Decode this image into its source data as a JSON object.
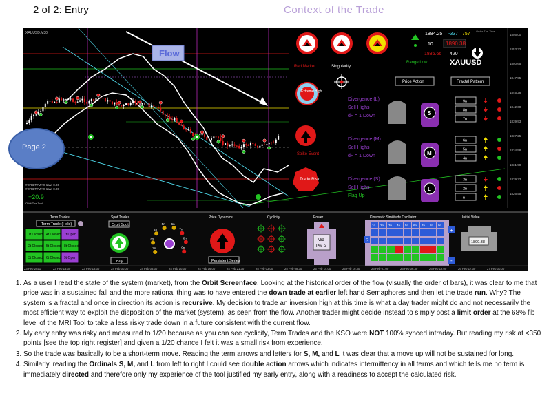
{
  "header": {
    "title": "2 of 2: Entry",
    "context": "Context of the Trade"
  },
  "chart": {
    "flow_label": "Flow",
    "symbol_info": "XAUUSD,M30",
    "prices": [
      "1856.00",
      "1853.33",
      "1850.65",
      "1847.95",
      "1845.28",
      "1842.60",
      "1839.93",
      "1837.25",
      "1834.58",
      "1831.90",
      "1829.23",
      "1826.55"
    ],
    "dates": [
      "23 Feb 2021",
      "23 Feb 13:30",
      "23 Feb 18:30",
      "24 Feb 00:00",
      "24 Feb 05:30",
      "24 Feb 10:30",
      "24 Feb 16:00",
      "24 Feb 21:30",
      "25 Feb 03:00",
      "25 Feb 08:30",
      "25 Feb 14:00",
      "25 Feb 19:30",
      "26 Feb 01:00",
      "26 Feb 06:30",
      "26 Feb 12:00",
      "26 Feb 17:30",
      "27 Feb 00:00"
    ],
    "value_label": "+20.9",
    "indicator_line1": "#ORBIT#MAX 1s/w 0.06",
    "indicator_line2": "#ORBIT#MAX 1s/w 0.00"
  },
  "panel": {
    "markets": [
      "Red Market",
      "Singularity",
      "Range Low"
    ],
    "extreme": "Extreme High",
    "spike": "Spike Event",
    "trade_risk": "Trade Risk",
    "ticker_values": {
      "a": "1884.25",
      "b": "-337",
      "c": "757",
      "d": "10",
      "e": "1890.38",
      "f": "1886.66",
      "g": "420"
    },
    "symbol": "XAUUSD",
    "small_top": "Order The Time",
    "price_action_btn": "Price Action",
    "fractal_btn": "Fractal Pattern",
    "divergences": [
      {
        "title": "Divergence (L)",
        "sub": "Sell Highs",
        "dF": "dF = 1 Down",
        "letter": "S"
      },
      {
        "title": "Divergence (M)",
        "sub": "Sell Highs",
        "dF": "dF = 1 Down",
        "letter": "M"
      },
      {
        "title": "Divergence (S)",
        "sub": "Sell Highs",
        "dF": "Flag Up",
        "letter": "L"
      }
    ],
    "fractal_rows": [
      "9n",
      "8n",
      "7n",
      "6n",
      "5n",
      "4n",
      "3n",
      "2n",
      "n"
    ]
  },
  "bottom": {
    "term_trades": {
      "title": "Term Trades",
      "btn": "Term Trade (Hold)",
      "cells": [
        "1t Closed",
        "4t Closed",
        "7t Open",
        "2t Closed",
        "5t Closed",
        "8t Closed",
        "3t Closed",
        "6t Closed",
        "9t Open"
      ]
    },
    "spot": {
      "title": "Spot Trades",
      "btn": "Orbit Spot",
      "buy": "Buy"
    },
    "gauge": {
      "labels": [
        "2n",
        "3n",
        "4n",
        "5n",
        "6n",
        "7n",
        "8n",
        "9n"
      ]
    },
    "price_dyn": {
      "title": "Price Dynamics",
      "btn": "Persistent Series"
    },
    "cyclicity": {
      "title": "Cyclicity"
    },
    "power": {
      "title": "Power",
      "mid": "Mid",
      "pw": "Pw -3"
    },
    "kso": {
      "title": "Kinematic Similitude Oscillator",
      "cols": [
        "1n",
        "2n",
        "3n",
        "4n",
        "5n",
        "6n",
        "7n",
        "8n",
        "9n"
      ],
      "rowlabel": "R"
    },
    "initial": {
      "title": "Initial Value",
      "value": "1890.38"
    }
  },
  "page_badge": "Page 2",
  "notes": [
    {
      "parts": [
        [
          "As a user I read the state of the system (market), from  the ",
          0
        ],
        [
          "Orbit Screenface",
          1
        ],
        [
          ". Looking at the historical order of the flow (visually the order of bars), it was clear to me that price was in a sustained fall and the more rational thing was to have entered the ",
          0
        ],
        [
          "down  trade at earlier",
          1
        ],
        [
          " left hand Semaphores and then let the trade ",
          0
        ],
        [
          "run",
          1
        ],
        [
          ". Why? The system is a fractal and once in direction its action is ",
          0
        ],
        [
          "recursive",
          1
        ],
        [
          ". My decision to trade an inversion high at this time is what a day trader might do and not necessarily the most efficient way to exploit the disposition of the market (system), as seen from the flow. Another trader might decide instead to simply post a ",
          0
        ],
        [
          "limit order",
          1
        ],
        [
          " at the 68% fib level of the MRI Tool to take a less risky trade down in a future consistent with the current flow.",
          0
        ]
      ]
    },
    {
      "parts": [
        [
          "My early entry was risky and measured to 1/20 because as you can see cyclicity, Term Trades and the KSO were ",
          0
        ],
        [
          "NOT",
          1
        ],
        [
          " 100% synced intraday. But reading my risk at <350 points [see the top right register] and given a 1/20 chance I felt it was a small risk from experience.",
          0
        ]
      ]
    },
    {
      "parts": [
        [
          "So the trade was basically to be a short-term move. Reading the term arrows and letters for ",
          0
        ],
        [
          "S, M,",
          1
        ],
        [
          " and ",
          0
        ],
        [
          "L",
          1
        ],
        [
          " it was clear that a move up will not be sustained for long.",
          0
        ]
      ]
    },
    {
      "parts": [
        [
          "Similarly, reading the ",
          0
        ],
        [
          "Ordinals S, M,",
          1
        ],
        [
          " and ",
          0
        ],
        [
          "L",
          1
        ],
        [
          " from left to right I could see ",
          0
        ],
        [
          "double action",
          1
        ],
        [
          " arrows which indicates intermittency in all terms and which tells me no term is immediately ",
          0
        ],
        [
          "directed",
          1
        ],
        [
          " and therefore  only my experience of the tool justified my early entry, along with a readiness to accept the calculated risk.",
          0
        ]
      ]
    }
  ],
  "colors": {
    "bg": "#000000",
    "green": "#22c322",
    "red": "#e01818",
    "yellow": "#f2e000",
    "purple": "#9a3fd2",
    "blue": "#2d5bd8",
    "gold": "#d8a800"
  }
}
